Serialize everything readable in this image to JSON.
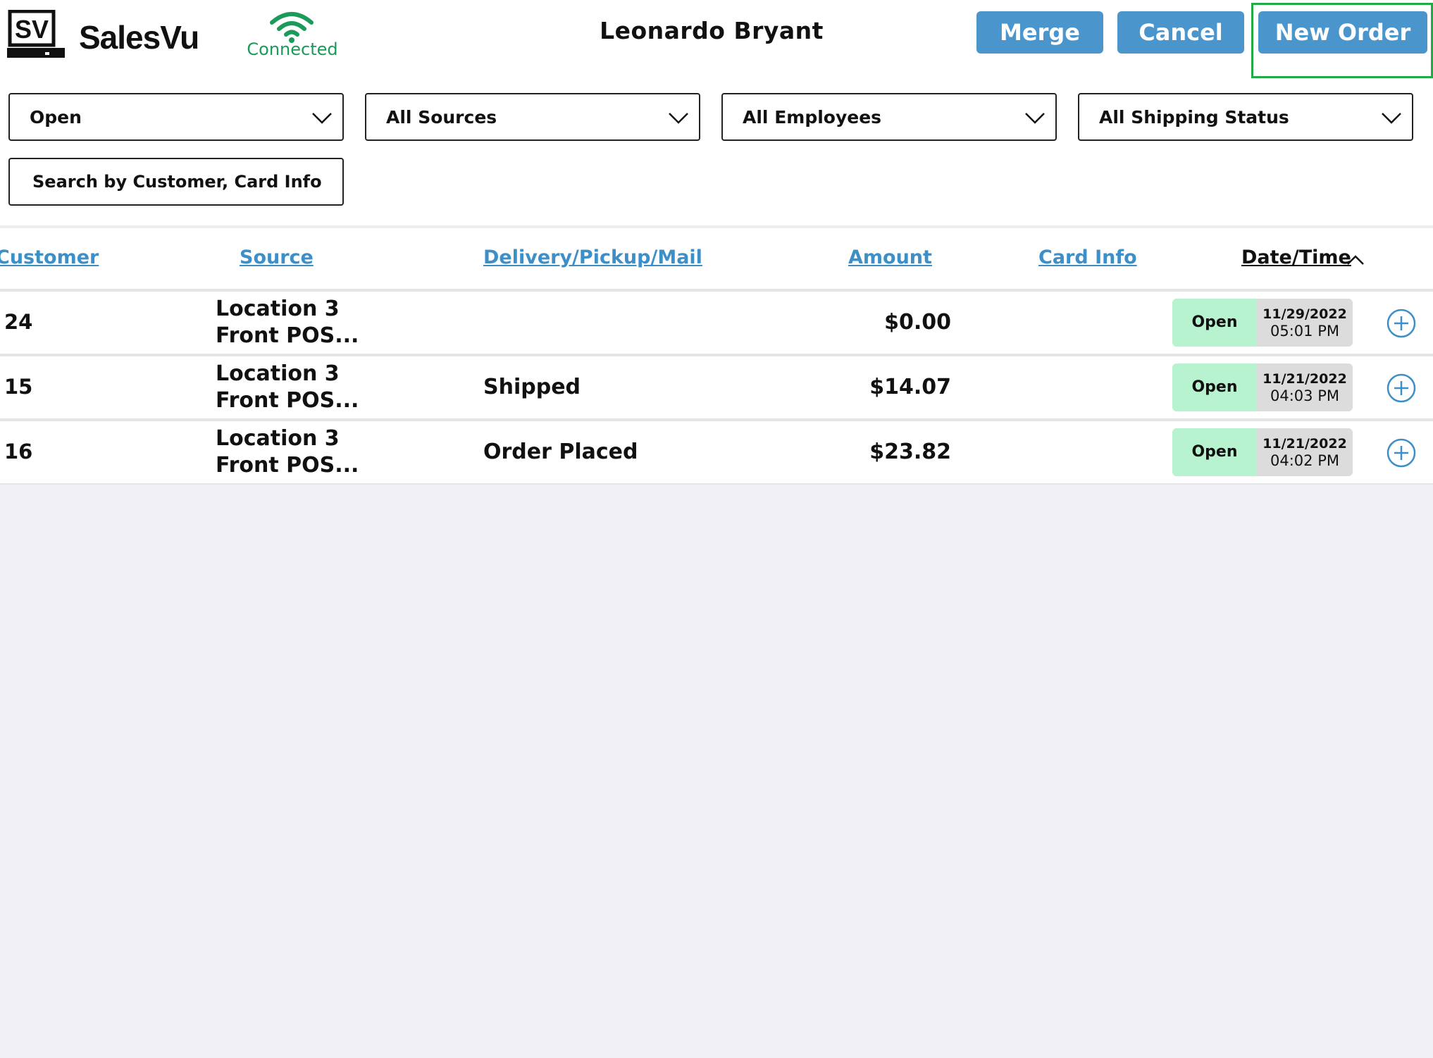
{
  "header": {
    "brand": "SalesVu",
    "logo_text": "SV",
    "connection_status": "Connected",
    "user_name": "Leonardo Bryant",
    "buttons": {
      "merge": "Merge",
      "cancel": "Cancel",
      "new_order": "New Order"
    }
  },
  "filters": {
    "status": "Open",
    "source": "All Sources",
    "employee": "All Employees",
    "shipping": "All Shipping Status",
    "search_placeholder": "Search by Customer, Card Info"
  },
  "table": {
    "columns": {
      "customer": "Customer",
      "source": "Source",
      "delivery": "Delivery/Pickup/Mail",
      "amount": "Amount",
      "card_info": "Card Info",
      "date_time": "Date/Time"
    },
    "rows": [
      {
        "customer": "24",
        "source_line1": "Location 3",
        "source_line2": "Front POS...",
        "delivery": "",
        "amount": "$0.00",
        "card_info": "",
        "status": "Open",
        "date": "11/29/2022",
        "time": "05:01 PM"
      },
      {
        "customer": "15",
        "source_line1": "Location 3",
        "source_line2": "Front POS...",
        "delivery": "Shipped",
        "amount": "$14.07",
        "card_info": "",
        "status": "Open",
        "date": "11/21/2022",
        "time": "04:03 PM"
      },
      {
        "customer": "16",
        "source_line1": "Location 3",
        "source_line2": "Front POS...",
        "delivery": "Order Placed",
        "amount": "$23.82",
        "card_info": "",
        "status": "Open",
        "date": "11/21/2022",
        "time": "04:02 PM"
      }
    ]
  },
  "colors": {
    "button_blue": "#4a95cc",
    "link_blue": "#3d8fc7",
    "connected_green": "#1b9a5a",
    "status_green_bg": "#b8f3d0",
    "highlight_green": "#22aa44"
  },
  "icons": [
    "salesvu-logo-icon",
    "wifi-icon",
    "chevron-down-icon",
    "sort-ascending-icon",
    "plus-circle-icon"
  ]
}
